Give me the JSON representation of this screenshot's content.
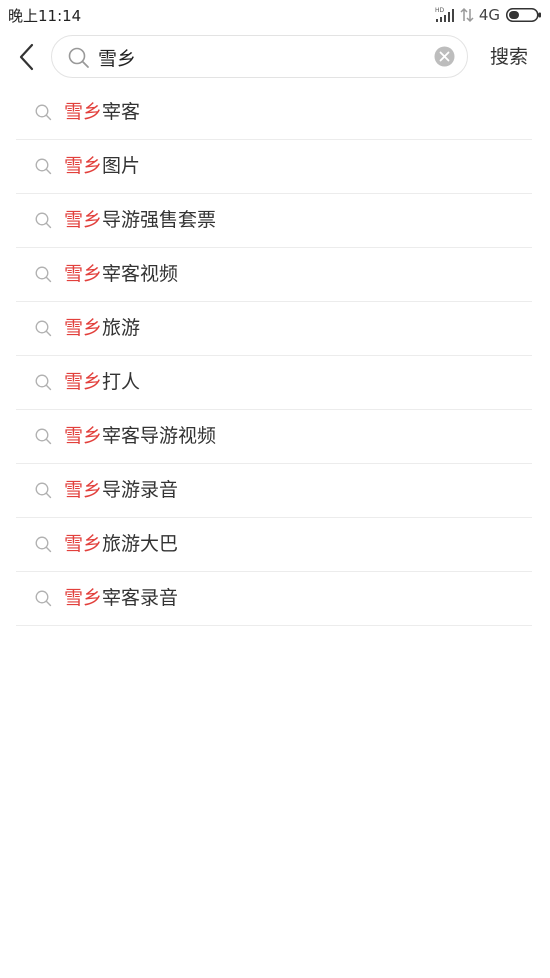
{
  "status_bar": {
    "time": "晚上11:14",
    "hd_label": "HD",
    "network": "4G"
  },
  "search": {
    "query": "雪乡",
    "submit_label": "搜索"
  },
  "suggestions": [
    {
      "highlight": "雪乡",
      "rest": "宰客"
    },
    {
      "highlight": "雪乡",
      "rest": "图片"
    },
    {
      "highlight": "雪乡",
      "rest": "导游强售套票"
    },
    {
      "highlight": "雪乡",
      "rest": "宰客视频"
    },
    {
      "highlight": "雪乡",
      "rest": "旅游"
    },
    {
      "highlight": "雪乡",
      "rest": "打人"
    },
    {
      "highlight": "雪乡",
      "rest": "宰客导游视频"
    },
    {
      "highlight": "雪乡",
      "rest": "导游录音"
    },
    {
      "highlight": "雪乡",
      "rest": "旅游大巴"
    },
    {
      "highlight": "雪乡",
      "rest": "宰客录音"
    }
  ],
  "colors": {
    "highlight": "#e2403c",
    "text": "#333333",
    "divider": "#ececec"
  },
  "icons": {
    "back": "chevron-left-icon",
    "search": "search-icon",
    "clear": "clear-icon",
    "signal": "signal-icon",
    "battery": "battery-icon"
  }
}
